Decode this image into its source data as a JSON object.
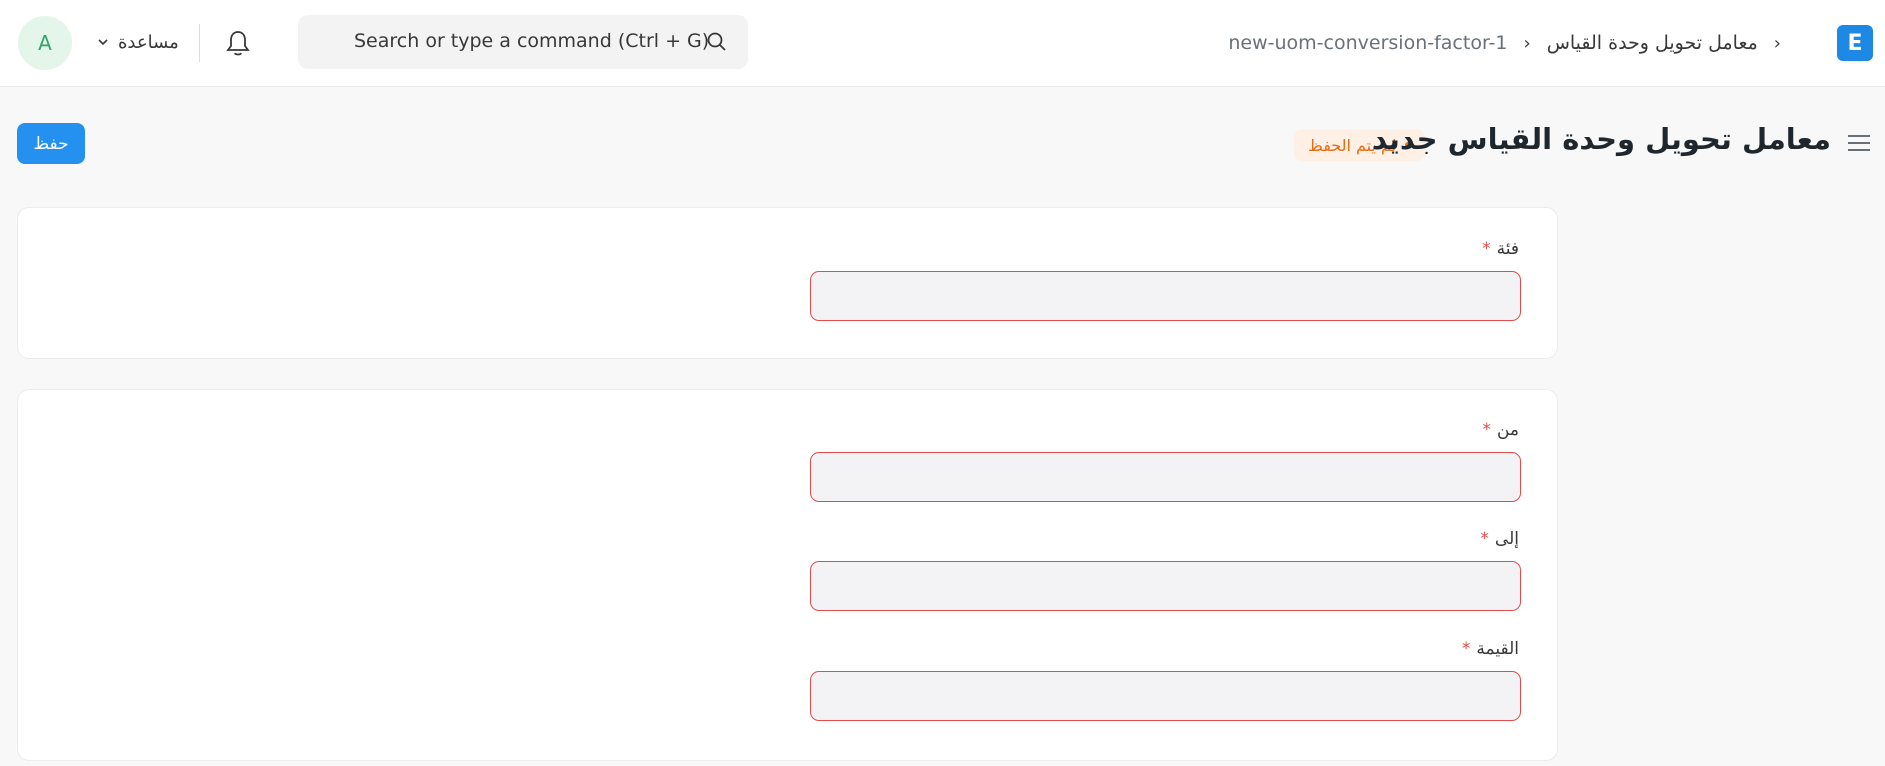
{
  "navbar": {
    "avatar_initial": "A",
    "help_label": "مساعدة",
    "search_placeholder": "Search or type a command (Ctrl + G)",
    "breadcrumb": {
      "module": "معامل تحويل وحدة القياس",
      "doc": "new-uom-conversion-factor-1"
    },
    "logo_letter": "E"
  },
  "page": {
    "title": "معامل تحويل وحدة القياس جديد",
    "status": "لم يتم الحفظ",
    "save_label": "حفظ"
  },
  "form": {
    "category": {
      "label": "فئة",
      "required": "*",
      "value": ""
    },
    "from": {
      "label": "من",
      "required": "*",
      "value": ""
    },
    "to": {
      "label": "إلى",
      "required": "*",
      "value": ""
    },
    "value": {
      "label": "القيمة",
      "required": "*",
      "value": ""
    }
  },
  "colors": {
    "primary": "#2490ef",
    "required": "#e24c4c",
    "status": "#e86c13"
  }
}
